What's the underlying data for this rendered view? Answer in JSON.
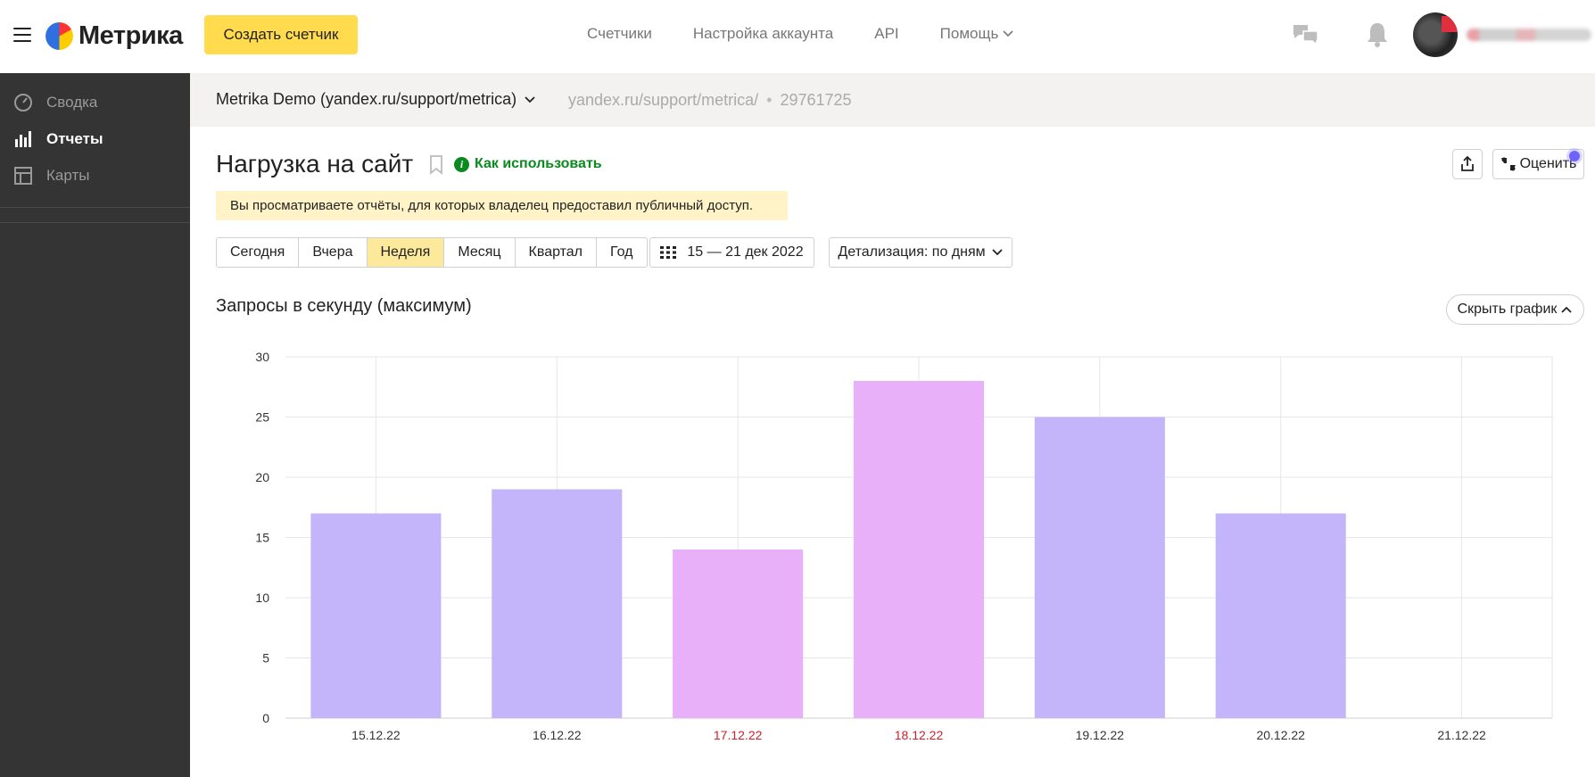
{
  "header": {
    "logo_text": "Метрика",
    "create_button": "Создать счетчик",
    "nav": [
      {
        "label": "Счетчики"
      },
      {
        "label": "Настройка аккаунта"
      },
      {
        "label": "API"
      },
      {
        "label": "Помощь"
      }
    ]
  },
  "sidebar": {
    "items": [
      {
        "label": "Сводка"
      },
      {
        "label": "Отчеты"
      },
      {
        "label": "Карты"
      }
    ]
  },
  "counter": {
    "name": "Metrika Demo (yandex.ru/support/metrica)",
    "url": "yandex.ru/support/metrica/",
    "id": "29761725"
  },
  "report": {
    "title": "Нагрузка на сайт",
    "howto_label": "Как использовать",
    "info_glyph": "i",
    "rate_label": "Оценить",
    "notice": "Вы просматриваете отчёты, для которых владелец предоставил публичный доступ.",
    "periods": [
      {
        "label": "Сегодня"
      },
      {
        "label": "Вчера"
      },
      {
        "label": "Неделя"
      },
      {
        "label": "Месяц"
      },
      {
        "label": "Квартал"
      },
      {
        "label": "Год"
      }
    ],
    "active_period": "Неделя",
    "date_range": "15 — 21 дек 2022",
    "detail_label": "Детализация: по дням",
    "chart_title": "Запросы в секунду (максимум)",
    "hide_chart_label": "Скрыть график"
  },
  "colors": {
    "accent": "#ffdb4d",
    "weekday_bar": "#c4b5fa",
    "weekend_bar": "#e8b0f8",
    "weekend_label": "#d0202a",
    "sidebar_bg": "#343434",
    "link_green": "#0a8a1f"
  },
  "chart_data": {
    "type": "bar",
    "title": "Запросы в секунду (максимум)",
    "categories": [
      "15.12.22",
      "16.12.22",
      "17.12.22",
      "18.12.22",
      "19.12.22",
      "20.12.22",
      "21.12.22"
    ],
    "values": [
      17,
      19,
      14,
      28,
      25,
      17,
      null
    ],
    "weekend": [
      false,
      false,
      true,
      true,
      false,
      false,
      false
    ],
    "ylim": [
      0,
      30
    ],
    "yticks": [
      0,
      5,
      10,
      15,
      20,
      25,
      30
    ],
    "grid": true,
    "legend": "none"
  }
}
